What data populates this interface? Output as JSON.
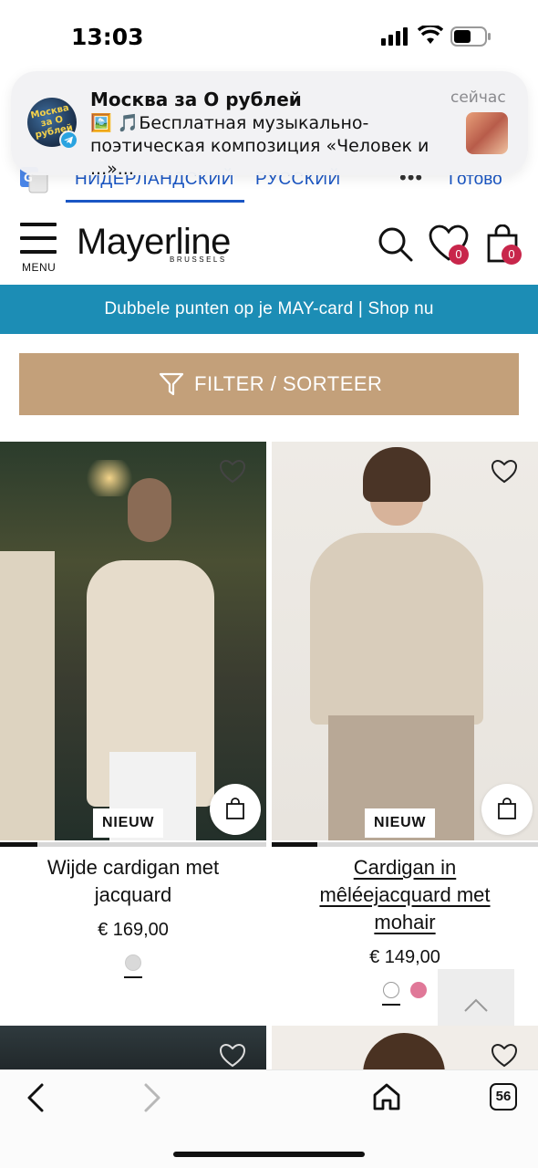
{
  "status": {
    "time": "13:03"
  },
  "notification": {
    "title": "Москва за О рублей",
    "time": "сейчас",
    "body": "🖼️ 🎵Бесплатная музыкально-поэтическая композиция «Человек и ...»...",
    "avatar_text": "Москва за О рублей",
    "app_badge_icon": "telegram-icon"
  },
  "translate": {
    "source_lang": "НИДЕРЛАНДСКИЙ",
    "target_lang": "РУССКИЙ",
    "more": "•••",
    "done": "Готово"
  },
  "header": {
    "menu_label": "MENU",
    "logo": "Mayerline",
    "logo_sub": "BRUSSELS",
    "wishlist_count": "0",
    "cart_count": "0"
  },
  "promo": {
    "text": "Dubbele punten op je MAY-card | Shop nu"
  },
  "filter": {
    "label": "FILTER / SORTEER"
  },
  "products": [
    {
      "badge": "NIEUW",
      "name": "Wijde cardigan met jacquard",
      "price": "€ 169,00",
      "swatches": [
        "#d9d9d9"
      ],
      "image_progress": 0.14
    },
    {
      "badge": "NIEUW",
      "name": "Cardigan in mêléejacquard met mohair",
      "price": "€ 149,00",
      "swatches": [
        "#ffffff",
        "#e07898"
      ],
      "image_progress": 0.17
    }
  ],
  "browser": {
    "tab_count": "56"
  },
  "colors": {
    "promo_bg": "#1c8db5",
    "filter_bg": "#c3a07a",
    "badge_red": "#c8264b",
    "link_blue": "#1a56c4"
  }
}
